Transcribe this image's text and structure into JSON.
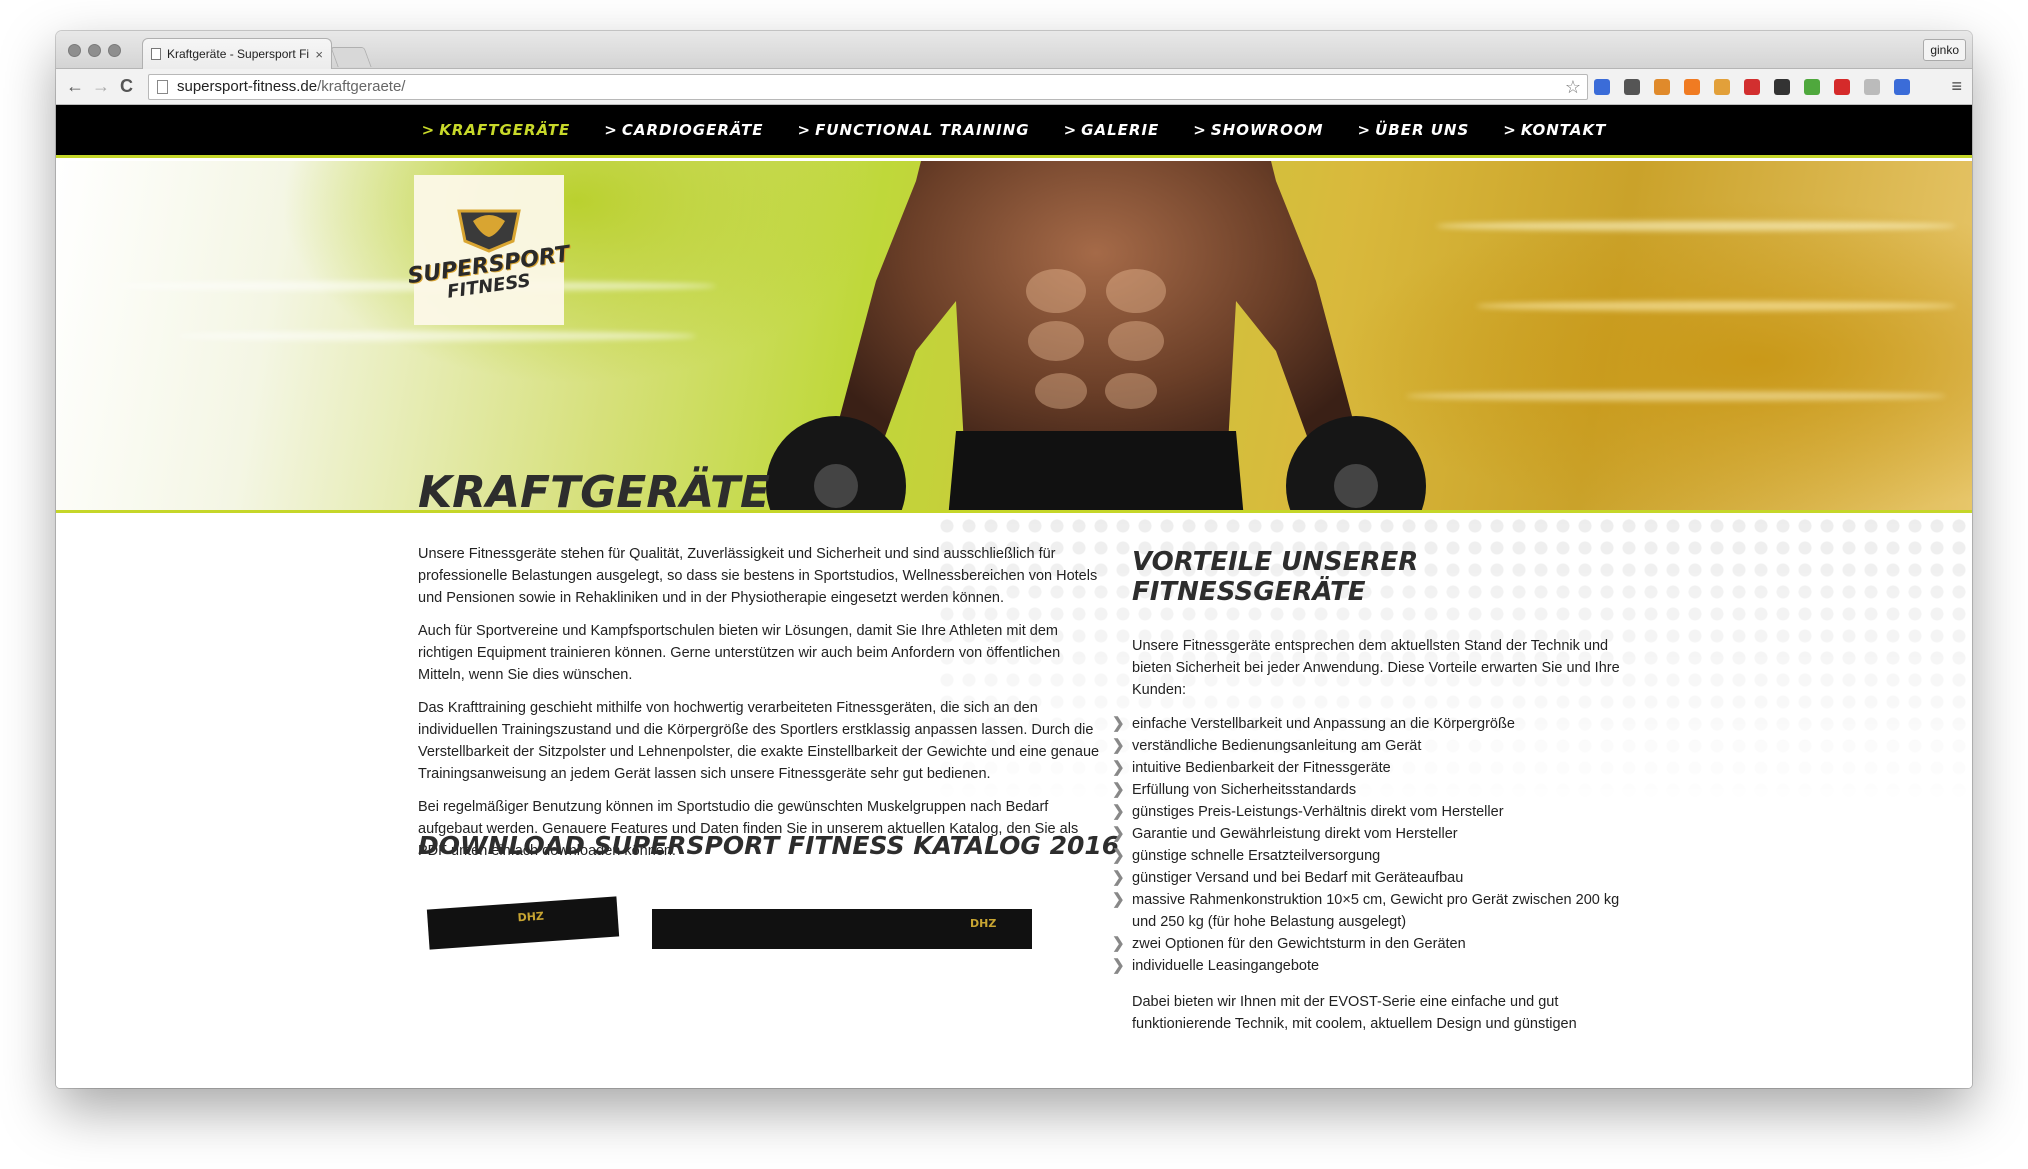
{
  "browser": {
    "tab_title": "Kraftgeräte - Supersport Fi",
    "tab_close": "×",
    "profile_label": "ginko",
    "url_domain": "supersport-fitness.de",
    "url_path": "/kraftgeraete/",
    "back_icon": "←",
    "forward_icon": "→",
    "reload_icon": "C",
    "star_icon": "☆",
    "menu_icon": "≡",
    "extensions": [
      {
        "name": "delicious-icon",
        "color": "#3b6cd8"
      },
      {
        "name": "eyedropper-icon",
        "color": "#555555"
      },
      {
        "name": "rss-icon",
        "color": "#e08a2b"
      },
      {
        "name": "chart-icon",
        "color": "#f07b22"
      },
      {
        "name": "face-icon",
        "color": "#e2a03a"
      },
      {
        "name": "red-square-icon",
        "color": "#d22f2f"
      },
      {
        "name": "black-star-icon",
        "color": "#333333"
      },
      {
        "name": "palette-icon",
        "color": "#4fa83d"
      },
      {
        "name": "abp-icon",
        "color": "#d52a2a"
      },
      {
        "name": "translate-icon",
        "color": "#bbbbbb"
      },
      {
        "name": "delicious2-icon",
        "color": "#3b6cd8"
      }
    ]
  },
  "nav": {
    "items": [
      {
        "label": "KRAFTGERÄTE",
        "active": true
      },
      {
        "label": "CARDIOGERÄTE",
        "active": false
      },
      {
        "label": "FUNCTIONAL TRAINING",
        "active": false
      },
      {
        "label": "GALERIE",
        "active": false
      },
      {
        "label": "SHOWROOM",
        "active": false
      },
      {
        "label": "ÜBER UNS",
        "active": false
      },
      {
        "label": "KONTAKT",
        "active": false
      }
    ],
    "chevron": ">",
    "accent_color": "#c8d92a"
  },
  "hero": {
    "logo_line1": "SUPERSPORT",
    "logo_line2": "FITNESS"
  },
  "main": {
    "title": "KRAFTGERÄTE",
    "paragraphs": [
      "Unsere Fitnessgeräte stehen für Qualität, Zuverlässigkeit und Sicherheit und sind ausschließlich für professionelle Belastungen ausgelegt, so dass sie bestens in Sportstudios, Wellnessbereichen von Hotels und Pensionen sowie in Rehakliniken und in der Physiotherapie eingesetzt werden können.",
      "Auch für Sportvereine und Kampfsportschulen bieten wir Lösungen, damit Sie Ihre Athleten mit dem richtigen Equipment trainieren können. Gerne unterstützen wir auch beim Anfordern von öffentlichen Mitteln, wenn Sie dies wünschen.",
      "Das Krafttraining geschieht mithilfe von hochwertig verarbeiteten Fitnessgeräten, die sich an den individuellen Trainingszustand und die Körpergröße des Sportlers erstklassig anpassen lassen. Durch die Verstellbarkeit der Sitzpolster und Lehnenpolster, die exakte Einstellbarkeit der Gewichte und eine genaue Trainingsanweisung an jedem Gerät lassen sich unsere Fitnessgeräte sehr gut bedienen.",
      "Bei regelmäßiger Benutzung können im Sportstudio die gewünschten Muskelgruppen nach Bedarf aufgebaut werden. Genauere Features und Daten finden Sie in unserem aktuellen Katalog, den Sie als PDF unten einfach downloaden können."
    ],
    "download_title": "DOWNLOAD SUPERSPORT FITNESS KATALOG 2016",
    "catalog_label": "DHZ"
  },
  "sidebar": {
    "title": "VORTEILE UNSERER FITNESSGERÄTE",
    "intro": "Unsere Fitnessgeräte entsprechen dem aktuellsten Stand der Technik und bieten Sicherheit bei jeder Anwendung. Diese Vorteile erwarten Sie und Ihre Kunden:",
    "bullet_symbol": "❯",
    "items": [
      "einfache Verstellbarkeit und Anpassung an die Körpergröße",
      "verständliche Bedienungsanleitung am Gerät",
      "intuitive Bedienbarkeit der Fitnessgeräte",
      "Erfüllung von Sicherheitsstandards",
      "günstiges Preis-Leistungs-Verhältnis direkt vom Hersteller",
      "Garantie und Gewährleistung direkt vom Hersteller",
      "günstige schnelle Ersatzteilversorgung",
      "günstiger Versand und bei Bedarf mit Geräteaufbau",
      "massive Rahmenkonstruktion 10×5 cm, Gewicht pro Gerät zwischen 200 kg und 250 kg (für hohe Belastung ausgelegt)",
      "zwei Optionen für den Gewichtsturm in den Geräten",
      "individuelle Leasingangebote"
    ],
    "outro": "Dabei bieten wir Ihnen mit der EVOST-Serie eine einfache und gut funktionierende Technik, mit coolem, aktuellem Design und günstigen"
  }
}
